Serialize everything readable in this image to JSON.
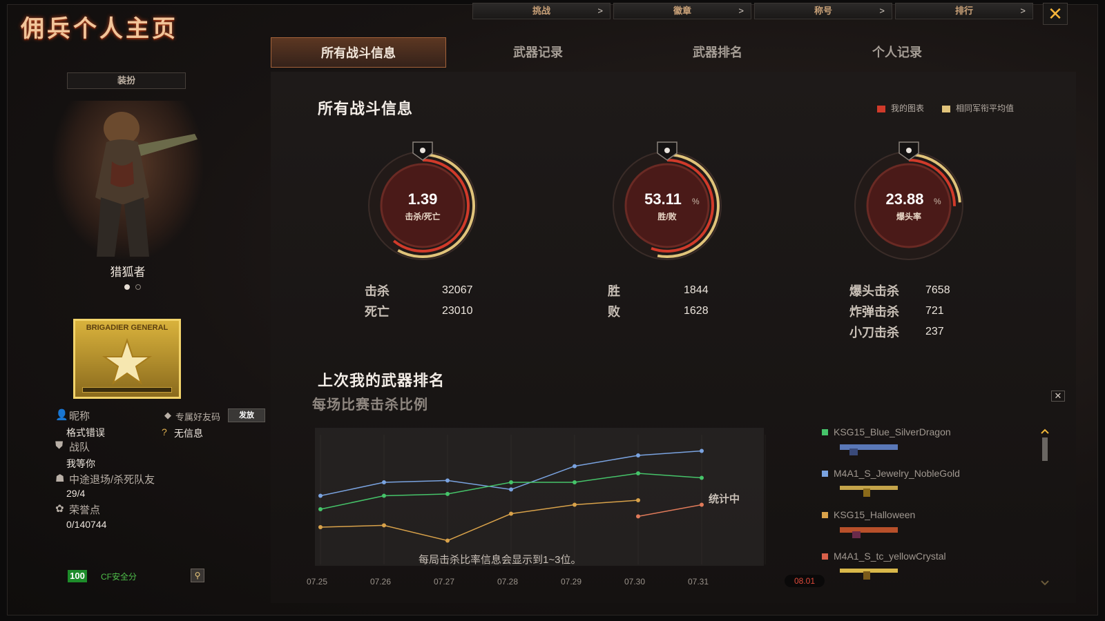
{
  "header": {
    "title": "佣兵个人主页",
    "nav": [
      "挑战",
      "徽章",
      "称号",
      "排行"
    ],
    "nav_chevron": ">",
    "close": "✕"
  },
  "tabs": [
    {
      "label": "所有战斗信息",
      "active": true
    },
    {
      "label": "武器记录",
      "active": false
    },
    {
      "label": "武器排名",
      "active": false
    },
    {
      "label": "个人记录",
      "active": false
    }
  ],
  "profile": {
    "outfit_button": "装扮",
    "character_name": "猎狐者",
    "rank_badge_text": "BRIGADIER GENERAL",
    "nickname_label": "昵称",
    "nickname_value": "格式错误",
    "friend_code_label": "专属好友码",
    "send_button": "发放",
    "friend_code_value": "无信息",
    "team_label": "战队",
    "team_value": "我等你",
    "quit_label": "中途退场/杀死队友",
    "quit_value": "29/4",
    "honor_label": "荣誉点",
    "honor_value": "0/140744",
    "safety_score": "100",
    "safety_label": "CF安全分"
  },
  "colors": {
    "accent": "#d9a25a",
    "my_chart": "#d03a2a",
    "avg_chart": "#e0c37a",
    "series_blue": "#7aa3e0",
    "series_green": "#46c46a",
    "series_orange": "#d9a24a"
  },
  "stats": {
    "section_title": "所有战斗信息",
    "legend_mine": "我的图表",
    "legend_avg": "相同军衔平均值",
    "gauges": [
      {
        "value": "1.39",
        "unit": "",
        "caption": "击杀/死亡",
        "fill": 0.58,
        "icon": "skull-icon"
      },
      {
        "value": "53.11",
        "unit": "%",
        "caption": "胜/败",
        "fill": 0.53,
        "icon": "crossed-guns-icon"
      },
      {
        "value": "23.88",
        "unit": "%",
        "caption": "爆头率",
        "fill": 0.24,
        "icon": "no-gun-icon"
      }
    ],
    "kills_label": "击杀",
    "kills_value": "32067",
    "deaths_label": "死亡",
    "deaths_value": "23010",
    "wins_label": "胜",
    "wins_value": "1844",
    "losses_label": "败",
    "losses_value": "1628",
    "headshot_label": "爆头击杀",
    "headshot_value": "7658",
    "bomb_label": "炸弹击杀",
    "bomb_value": "721",
    "knife_label": "小刀击杀",
    "knife_value": "237"
  },
  "weapon_rank": {
    "title": "上次我的武器排名",
    "subtitle": "每场比赛击杀比例",
    "status": "统计中",
    "note": "每局击杀比率信息会显示到1~3位。",
    "close": "✕",
    "weapons": [
      {
        "name": "KSG15_Blue_SilverDragon",
        "color": "#46c46a"
      },
      {
        "name": "M4A1_S_Jewelry_NobleGold",
        "color": "#7aa3e0"
      },
      {
        "name": "KSG15_Halloween",
        "color": "#d9a24a"
      },
      {
        "name": "M4A1_S_tc_yellowCrystal",
        "color": "#d9604a"
      }
    ]
  },
  "chart_data": {
    "type": "line",
    "categories": [
      "07.25",
      "07.26",
      "07.27",
      "07.28",
      "07.29",
      "07.30",
      "07.31",
      "08.01"
    ],
    "series": [
      {
        "values": [
          0.45,
          0.6,
          0.62,
          0.52,
          0.78,
          0.9,
          0.95
        ]
      },
      {
        "values": [
          0.3,
          0.45,
          0.47,
          0.6,
          0.6,
          0.7,
          0.65
        ]
      },
      {
        "values": [
          0.1,
          0.12,
          -0.05,
          0.25,
          0.35,
          0.4,
          null
        ]
      },
      {
        "values": [
          null,
          null,
          null,
          null,
          null,
          0.22,
          0.35
        ]
      }
    ],
    "active_category": "08.01",
    "grid": true
  }
}
